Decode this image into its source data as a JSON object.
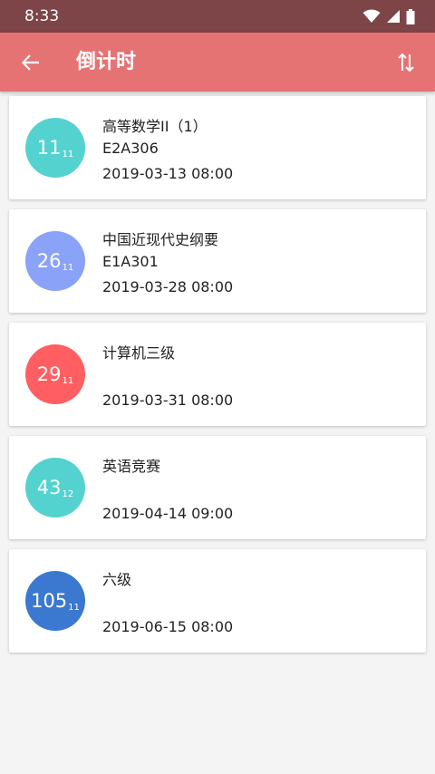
{
  "status_bar": {
    "time": "8:33"
  },
  "app_bar": {
    "title": "倒计时"
  },
  "exams": [
    {
      "days": "11",
      "hours": "11",
      "name": "高等数学II（1）",
      "room": "E2A306",
      "datetime": "2019-03-13 08:00",
      "color": "#54d2d0"
    },
    {
      "days": "26",
      "hours": "11",
      "name": "中国近现代史纲要",
      "room": "E1A301",
      "datetime": "2019-03-28 08:00",
      "color": "#8aa2f7"
    },
    {
      "days": "29",
      "hours": "11",
      "name": "计算机三级",
      "room": "",
      "datetime": "2019-03-31 08:00",
      "color": "#ff5f62"
    },
    {
      "days": "43",
      "hours": "12",
      "name": "英语竞赛",
      "room": "",
      "datetime": "2019-04-14 09:00",
      "color": "#54d2d0"
    },
    {
      "days": "105",
      "hours": "11",
      "name": "六级",
      "room": "",
      "datetime": "2019-06-15 08:00",
      "color": "#3b78cf"
    }
  ]
}
